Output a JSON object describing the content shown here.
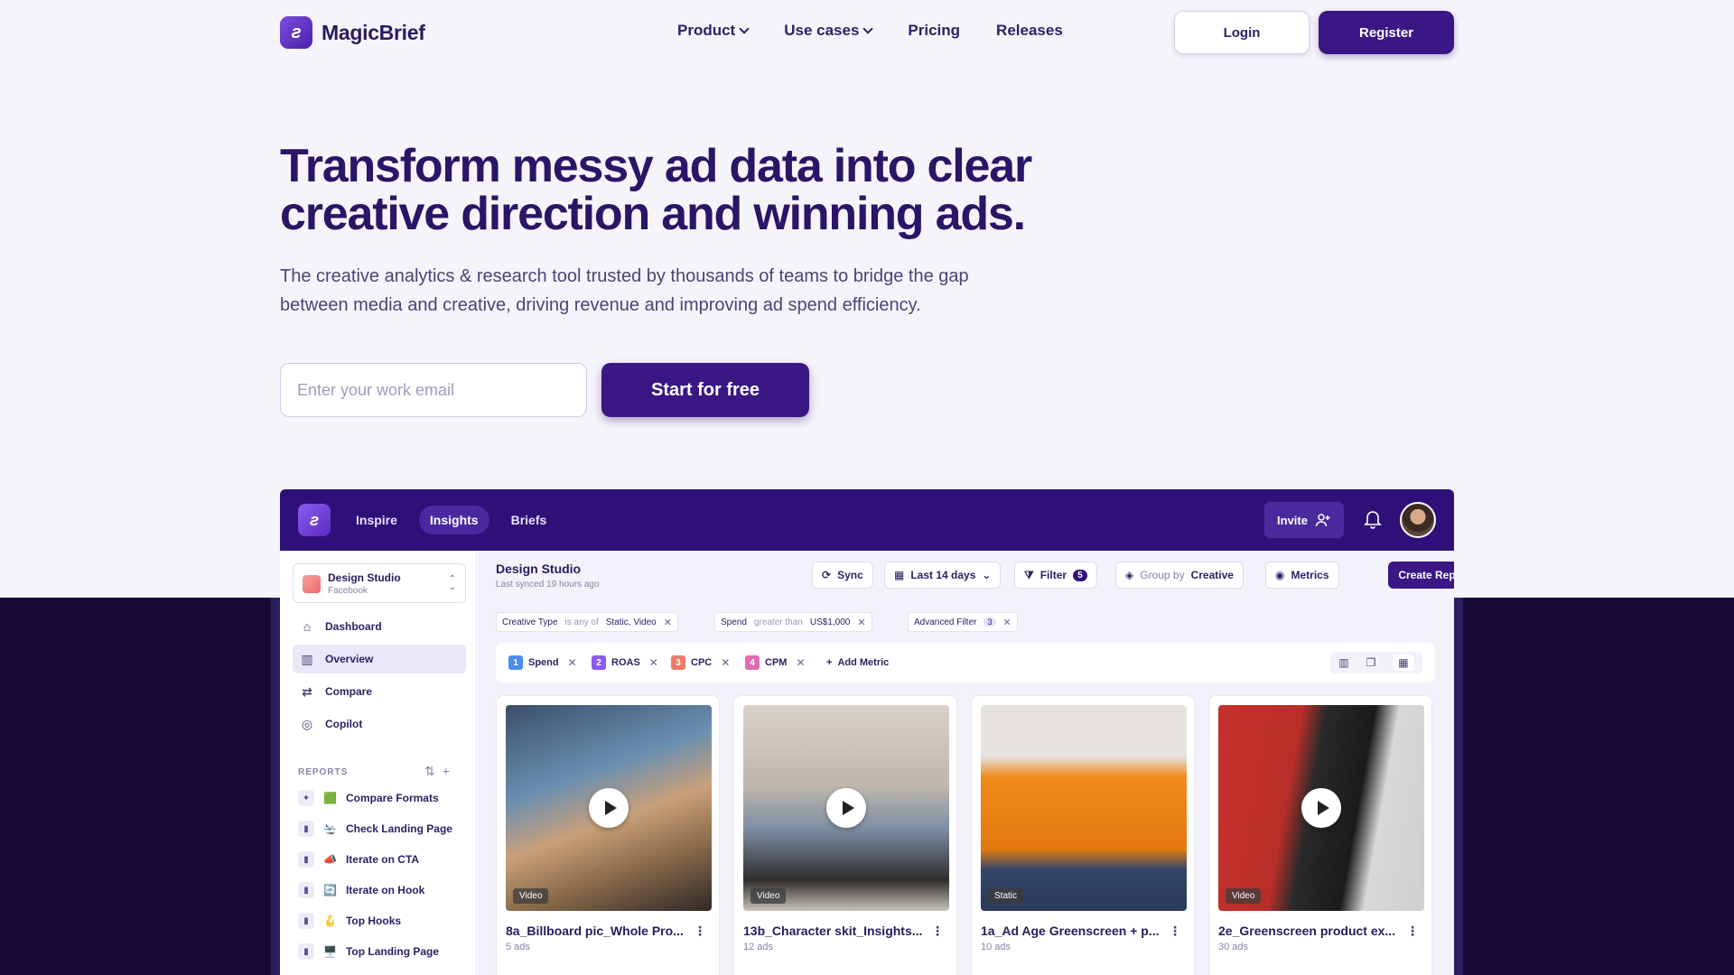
{
  "brand": {
    "name": "MagicBrief"
  },
  "nav": {
    "links": [
      "Product",
      "Use cases",
      "Pricing",
      "Releases"
    ],
    "login": "Login",
    "register": "Register"
  },
  "hero": {
    "title_line1": "Transform messy ad data into clear",
    "title_line2": "creative direction and winning ads.",
    "subtitle": "The creative analytics & research tool trusted by thousands of teams to bridge the gap between media and creative, driving revenue and improving ad spend efficiency.",
    "email_placeholder": "Enter your work email",
    "cta": "Start for free"
  },
  "app": {
    "tabs": [
      "Inspire",
      "Insights",
      "Briefs"
    ],
    "invite": "Invite",
    "workspace": {
      "name": "Design Studio",
      "platform": "Facebook"
    },
    "sidebar": [
      "Dashboard",
      "Overview",
      "Compare",
      "Copilot"
    ],
    "reports_label": "REPORTS",
    "reports": [
      {
        "emoji": "🟩",
        "label": "Compare Formats"
      },
      {
        "emoji": "🛬",
        "label": "Check Landing Page"
      },
      {
        "emoji": "📣",
        "label": "Iterate on CTA"
      },
      {
        "emoji": "🔄",
        "label": "Iterate on Hook"
      },
      {
        "emoji": "🪝",
        "label": "Top Hooks"
      },
      {
        "emoji": "🖥️",
        "label": "Top Landing Page"
      }
    ],
    "main": {
      "title": "Design Studio",
      "synced": "Last synced 19 hours ago",
      "sync": "Sync",
      "range": "Last 14 days",
      "filter": "Filter",
      "filter_count": "5",
      "group_prefix": "Group by",
      "group_value": "Creative",
      "metrics": "Metrics",
      "create_report": "Create Report"
    },
    "filters": {
      "creative_type": "Creative Type",
      "is_any_of": "is any of",
      "types": "Static, Video",
      "spend": "Spend",
      "greater_than": "greater than",
      "amount": "US$1,000",
      "advanced": "Advanced Filter",
      "advanced_count": "3"
    },
    "metric_chips": [
      {
        "num": "1",
        "label": "Spend",
        "color": "#4a8ef0"
      },
      {
        "num": "2",
        "label": "ROAS",
        "color": "#8a5cf0"
      },
      {
        "num": "3",
        "label": "CPC",
        "color": "#f07a6a"
      },
      {
        "num": "4",
        "label": "CPM",
        "color": "#e06ab0"
      }
    ],
    "add_metric": "Add Metric",
    "cards": [
      {
        "title": "8a_Billboard pic_Whole Pro...",
        "ads": "5 ads",
        "type": "Video"
      },
      {
        "title": "13b_Character skit_Insights...",
        "ads": "12 ads",
        "type": "Video"
      },
      {
        "title": "1a_Ad Age Greenscreen + p...",
        "ads": "10 ads",
        "type": "Static"
      },
      {
        "title": "2e_Greenscreen product ex...",
        "ads": "30 ads",
        "type": "Video"
      }
    ]
  }
}
